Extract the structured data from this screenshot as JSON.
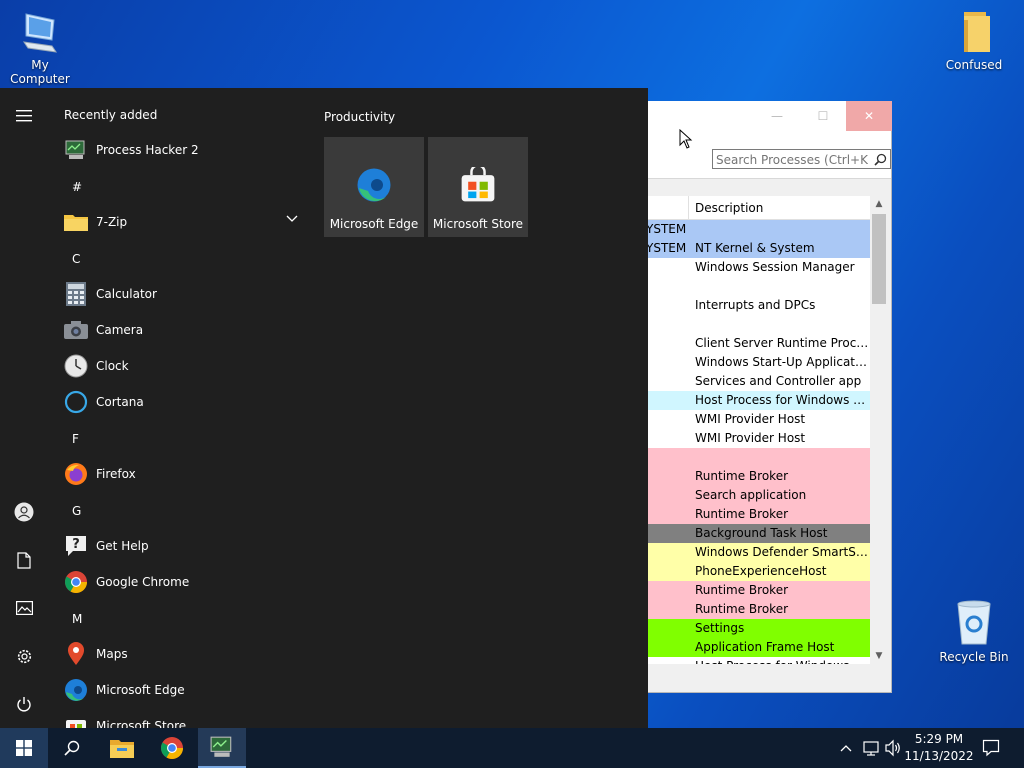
{
  "desktop": {
    "icons": [
      {
        "label": "My Computer"
      },
      {
        "label": "Confused"
      },
      {
        "label": "Recycle Bin"
      }
    ]
  },
  "process_hacker": {
    "title_buttons": {
      "minimize": "—",
      "maximize": "☐",
      "close": "✕"
    },
    "search_placeholder": "Search Processes (Ctrl+K)",
    "column_header": "Description",
    "rows": [
      {
        "user": "YSTEM",
        "desc": "",
        "color": "#aac8f5"
      },
      {
        "user": "YSTEM",
        "desc": "NT Kernel & System",
        "color": "#aac8f5"
      },
      {
        "user": "",
        "desc": "Windows Session Manager",
        "color": "#ffffff"
      },
      {
        "user": "",
        "desc": "",
        "color": "#ffffff"
      },
      {
        "user": "",
        "desc": "Interrupts and DPCs",
        "color": "#ffffff"
      },
      {
        "user": "",
        "desc": "",
        "color": "#ffffff"
      },
      {
        "user": "",
        "desc": "Client Server Runtime Process",
        "color": "#ffffff"
      },
      {
        "user": "",
        "desc": "Windows Start-Up Application",
        "color": "#ffffff"
      },
      {
        "user": "",
        "desc": "Services and Controller app",
        "color": "#ffffff"
      },
      {
        "user": "",
        "desc": "Host Process for Windows Ser...",
        "color": "#d0f6ff"
      },
      {
        "user": "",
        "desc": "WMI Provider Host",
        "color": "#ffffff"
      },
      {
        "user": "",
        "desc": "WMI Provider Host",
        "color": "#ffffff"
      },
      {
        "user": "",
        "desc": "",
        "color": "#ffc0cb"
      },
      {
        "user": "",
        "desc": "Runtime Broker",
        "color": "#ffc0cb"
      },
      {
        "user": "",
        "desc": "Search application",
        "color": "#ffc0cb"
      },
      {
        "user": "",
        "desc": "Runtime Broker",
        "color": "#ffc0cb"
      },
      {
        "user": "",
        "desc": "Background Task Host",
        "color": "#808080"
      },
      {
        "user": "",
        "desc": "Windows Defender SmartScre...",
        "color": "#ffffa8"
      },
      {
        "user": "",
        "desc": "PhoneExperienceHost",
        "color": "#ffffa8"
      },
      {
        "user": "",
        "desc": "Runtime Broker",
        "color": "#ffc0cb"
      },
      {
        "user": "",
        "desc": "Runtime Broker",
        "color": "#ffc0cb"
      },
      {
        "user": "",
        "desc": "Settings",
        "color": "#80ff00"
      },
      {
        "user": "",
        "desc": "Application Frame Host",
        "color": "#80ff00"
      },
      {
        "user": "",
        "desc": "Host Process for Windows Se...",
        "color": "#ffffff"
      }
    ]
  },
  "start_menu": {
    "recently_added_label": "Recently added",
    "recent_app": "Process Hacker 2",
    "groups": [
      {
        "letter": "#",
        "apps": [
          {
            "label": "7-Zip",
            "icon": "folder-icon"
          }
        ]
      },
      {
        "letter": "C",
        "apps": [
          {
            "label": "Calculator",
            "icon": "calculator-icon"
          },
          {
            "label": "Camera",
            "icon": "camera-icon"
          },
          {
            "label": "Clock",
            "icon": "clock-icon"
          },
          {
            "label": "Cortana",
            "icon": "cortana-icon"
          }
        ]
      },
      {
        "letter": "F",
        "apps": [
          {
            "label": "Firefox",
            "icon": "firefox-icon"
          }
        ]
      },
      {
        "letter": "G",
        "apps": [
          {
            "label": "Get Help",
            "icon": "help-icon"
          },
          {
            "label": "Google Chrome",
            "icon": "chrome-icon"
          }
        ]
      },
      {
        "letter": "M",
        "apps": [
          {
            "label": "Maps",
            "icon": "maps-icon"
          },
          {
            "label": "Microsoft Edge",
            "icon": "edge-icon"
          },
          {
            "label": "Microsoft Store",
            "icon": "store-icon"
          }
        ]
      }
    ],
    "tiles_group": "Productivity",
    "tiles": [
      {
        "label": "Microsoft Edge",
        "icon": "edge-icon"
      },
      {
        "label": "Microsoft Store",
        "icon": "store-icon"
      }
    ]
  },
  "taskbar": {
    "time": "5:29 PM",
    "date": "11/13/2022"
  }
}
